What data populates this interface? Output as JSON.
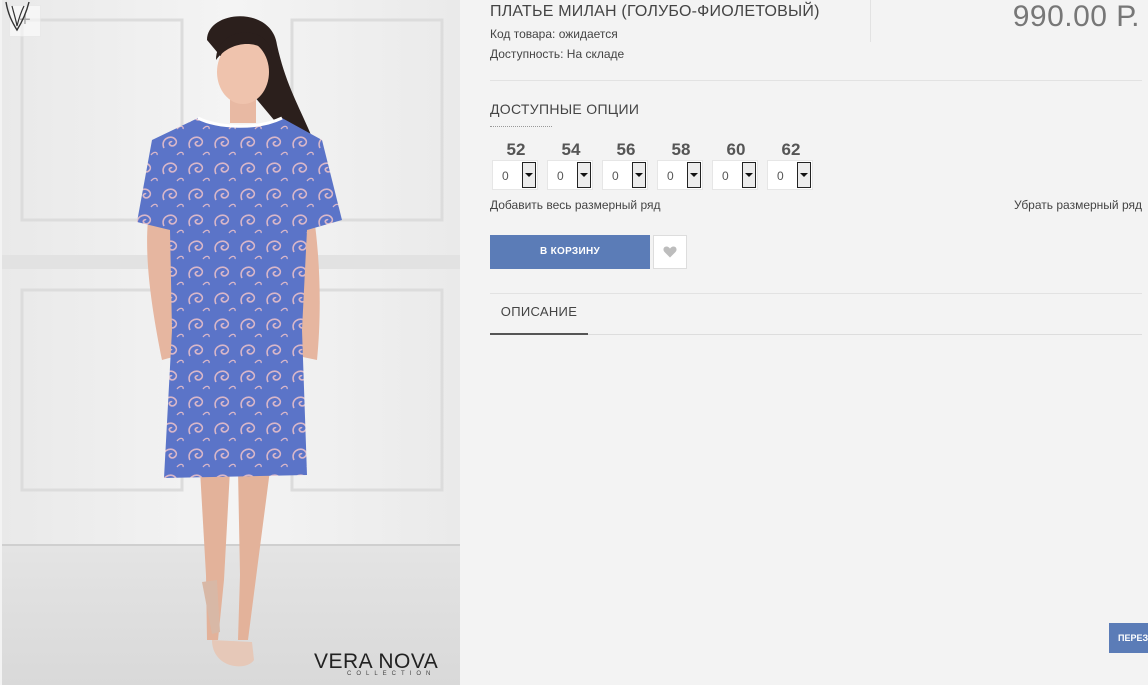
{
  "product": {
    "title": "ПЛАТЬЕ МИЛАН (ГОЛУБО-ФИОЛЕТОВЫЙ)",
    "code_label": "Код товара: ожидается",
    "availability_label": "Доступность: На складе",
    "price": "990.00 Р."
  },
  "gallery": {
    "zoom_icon": "+",
    "brand_text": "VERA NOVA",
    "brand_sub": "COLLECTION",
    "dress_color": "#5b74c8"
  },
  "options": {
    "title": "ДОСТУПНЫЕ ОПЦИИ",
    "sizes": [
      {
        "label": "52",
        "value": "0"
      },
      {
        "label": "54",
        "value": "0"
      },
      {
        "label": "56",
        "value": "0"
      },
      {
        "label": "58",
        "value": "0"
      },
      {
        "label": "60",
        "value": "0"
      },
      {
        "label": "62",
        "value": "0"
      }
    ],
    "add_all_label": "Добавить весь размерный ряд",
    "remove_all_label": "Убрать размерный ряд"
  },
  "actions": {
    "cart_label": "В КОРЗИНУ",
    "wishlist_icon": "heart-icon"
  },
  "tabs": [
    {
      "label": "ОПИСАНИЕ"
    }
  ],
  "side_button": {
    "label": "ПЕРЕЗ"
  },
  "colors": {
    "accent": "#5b7cb7",
    "price": "#777777"
  }
}
